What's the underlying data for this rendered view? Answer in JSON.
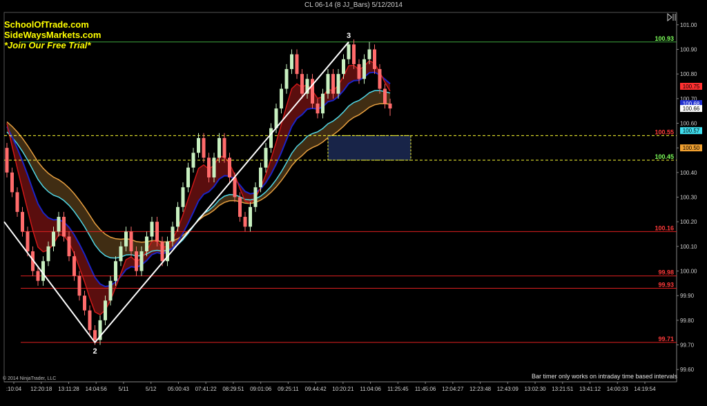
{
  "chart_title": "CL 06-14 (8 JJ_Bars)  5/12/2014",
  "watermark": [
    "SchoolOfTrade.com",
    "SideWaysMarkets.com",
    "*Join Our Free Trial*"
  ],
  "copyright": "© 2014 NinjaTrader, LLC",
  "bar_timer_note": "Bar timer only works on intraday time based intervals",
  "colors": {
    "background": "#000000",
    "bar_up": "#c8f0c0",
    "bar_down": "#ff6b6b",
    "zigzag": "#ffffff",
    "level_green": "#3ea53e",
    "level_red": "#e02020",
    "level_yellow": "#ffff33",
    "zone_fill": "#1c2a55",
    "ema_fast": "#d01818",
    "ema_mid": "#1a24c8",
    "ema_slow_a": "#50d8e8",
    "ema_slow_b": "#e8a040"
  },
  "chart_data": {
    "type": "candlestick",
    "instrument": "CL 06-14",
    "ylim": [
      99.55,
      101.05
    ],
    "y_ticks": [
      "101.00",
      "100.90",
      "100.80",
      "100.70",
      "100.60",
      "100.50",
      "100.40",
      "100.30",
      "100.20",
      "100.10",
      "100.00",
      "99.90",
      "99.80",
      "99.70",
      "99.60"
    ],
    "x_ticks": [
      ":10:04",
      "12:20:18",
      "13:11:28",
      "14:04:56",
      "5/11",
      "5/12",
      "05:00:43",
      "07:41:22",
      "08:29:51",
      "09:01:06",
      "09:25:11",
      "09:44:42",
      "10:20:21",
      "11:04:06",
      "11:25:45",
      "11:45:06",
      "12:04:27",
      "12:23:48",
      "12:43:09",
      "13:02:30",
      "13:21:51",
      "13:41:12",
      "14:00:33",
      "14:19:54"
    ],
    "bars": [
      [
        100.5,
        100.52,
        100.38,
        100.4
      ],
      [
        100.4,
        100.42,
        100.3,
        100.32
      ],
      [
        100.32,
        100.34,
        100.22,
        100.24
      ],
      [
        100.24,
        100.26,
        100.14,
        100.16
      ],
      [
        100.16,
        100.18,
        100.06,
        100.08
      ],
      [
        100.08,
        100.1,
        99.98,
        100.0
      ],
      [
        100.0,
        100.02,
        99.94,
        99.96
      ],
      [
        99.96,
        100.06,
        99.94,
        100.04
      ],
      [
        100.04,
        100.12,
        100.02,
        100.1
      ],
      [
        100.1,
        100.18,
        100.08,
        100.16
      ],
      [
        100.16,
        100.24,
        100.14,
        100.22
      ],
      [
        100.22,
        100.24,
        100.12,
        100.14
      ],
      [
        100.14,
        100.16,
        100.04,
        100.06
      ],
      [
        100.06,
        100.08,
        99.96,
        99.98
      ],
      [
        99.98,
        100.0,
        99.88,
        99.9
      ],
      [
        99.9,
        99.92,
        99.82,
        99.84
      ],
      [
        99.84,
        99.86,
        99.74,
        99.76
      ],
      [
        99.76,
        99.78,
        99.7,
        99.72
      ],
      [
        99.72,
        99.82,
        99.7,
        99.8
      ],
      [
        99.8,
        99.9,
        99.78,
        99.88
      ],
      [
        99.88,
        99.98,
        99.86,
        99.96
      ],
      [
        99.96,
        100.06,
        99.94,
        100.04
      ],
      [
        100.04,
        100.12,
        100.02,
        100.1
      ],
      [
        100.1,
        100.18,
        100.08,
        100.16
      ],
      [
        100.16,
        100.18,
        100.06,
        100.08
      ],
      [
        100.08,
        100.1,
        99.98,
        100.0
      ],
      [
        100.0,
        100.1,
        99.98,
        100.08
      ],
      [
        100.08,
        100.16,
        100.06,
        100.14
      ],
      [
        100.14,
        100.22,
        100.12,
        100.2
      ],
      [
        100.2,
        100.22,
        100.1,
        100.12
      ],
      [
        100.12,
        100.14,
        100.02,
        100.04
      ],
      [
        100.04,
        100.14,
        100.02,
        100.12
      ],
      [
        100.12,
        100.2,
        100.1,
        100.18
      ],
      [
        100.18,
        100.28,
        100.16,
        100.26
      ],
      [
        100.26,
        100.36,
        100.24,
        100.34
      ],
      [
        100.34,
        100.44,
        100.32,
        100.42
      ],
      [
        100.42,
        100.5,
        100.4,
        100.48
      ],
      [
        100.48,
        100.56,
        100.46,
        100.54
      ],
      [
        100.54,
        100.56,
        100.44,
        100.46
      ],
      [
        100.46,
        100.48,
        100.36,
        100.38
      ],
      [
        100.38,
        100.48,
        100.36,
        100.46
      ],
      [
        100.46,
        100.56,
        100.44,
        100.54
      ],
      [
        100.54,
        100.56,
        100.44,
        100.46
      ],
      [
        100.46,
        100.48,
        100.36,
        100.38
      ],
      [
        100.38,
        100.4,
        100.28,
        100.3
      ],
      [
        100.3,
        100.32,
        100.2,
        100.22
      ],
      [
        100.22,
        100.24,
        100.16,
        100.18
      ],
      [
        100.18,
        100.28,
        100.16,
        100.26
      ],
      [
        100.26,
        100.36,
        100.24,
        100.34
      ],
      [
        100.34,
        100.44,
        100.32,
        100.42
      ],
      [
        100.42,
        100.52,
        100.4,
        100.5
      ],
      [
        100.5,
        100.6,
        100.48,
        100.58
      ],
      [
        100.58,
        100.68,
        100.56,
        100.66
      ],
      [
        100.66,
        100.76,
        100.64,
        100.74
      ],
      [
        100.74,
        100.84,
        100.72,
        100.82
      ],
      [
        100.82,
        100.9,
        100.8,
        100.88
      ],
      [
        100.88,
        100.9,
        100.78,
        100.8
      ],
      [
        100.8,
        100.82,
        100.7,
        100.72
      ],
      [
        100.72,
        100.8,
        100.7,
        100.78
      ],
      [
        100.78,
        100.8,
        100.66,
        100.68
      ],
      [
        100.68,
        100.7,
        100.62,
        100.64
      ],
      [
        100.64,
        100.74,
        100.62,
        100.72
      ],
      [
        100.72,
        100.82,
        100.7,
        100.8
      ],
      [
        100.8,
        100.82,
        100.7,
        100.72
      ],
      [
        100.72,
        100.82,
        100.7,
        100.8
      ],
      [
        100.8,
        100.88,
        100.78,
        100.86
      ],
      [
        100.86,
        100.93,
        100.84,
        100.92
      ],
      [
        100.92,
        100.94,
        100.82,
        100.84
      ],
      [
        100.84,
        100.86,
        100.76,
        100.78
      ],
      [
        100.78,
        100.88,
        100.76,
        100.86
      ],
      [
        100.86,
        100.93,
        100.84,
        100.9
      ],
      [
        100.9,
        100.92,
        100.8,
        100.82
      ],
      [
        100.82,
        100.84,
        100.72,
        100.74
      ],
      [
        100.74,
        100.76,
        100.66,
        100.68
      ],
      [
        100.68,
        100.7,
        100.63,
        100.66
      ]
    ],
    "levels": [
      {
        "label": "100.93",
        "value": 100.93,
        "color": "green"
      },
      {
        "label": "100.55",
        "value": 100.55,
        "color": "red"
      },
      {
        "label": "100.45",
        "value": 100.45,
        "color": "green"
      },
      {
        "label": "100.16",
        "value": 100.16,
        "color": "red"
      },
      {
        "label": "99.98",
        "value": 99.98,
        "color": "red"
      },
      {
        "label": "99.93",
        "value": 99.93,
        "color": "red"
      },
      {
        "label": "99.71",
        "value": 99.71,
        "color": "red"
      }
    ],
    "price_flags": [
      {
        "label": "100.75",
        "value": 100.75,
        "bg": "#ff3030",
        "fg": "#000000"
      },
      {
        "label": "100.68",
        "value": 100.68,
        "bg": "#2030d0",
        "fg": "#ffffff"
      },
      {
        "label": "100.66",
        "value": 100.66,
        "bg": "#ffffff",
        "fg": "#000000"
      },
      {
        "label": "100.57",
        "value": 100.57,
        "bg": "#40e0f0",
        "fg": "#000000"
      },
      {
        "label": "100.50",
        "value": 100.5,
        "bg": "#f0a030",
        "fg": "#000000"
      }
    ],
    "zigzag_labels": [
      "2",
      "3"
    ],
    "zigzag": [
      [
        0,
        100.2
      ],
      [
        17,
        99.71
      ],
      [
        66,
        100.93
      ],
      [
        17,
        99.71
      ]
    ],
    "zone": {
      "from_bar": 62,
      "to_bar": 78,
      "top": 100.55,
      "bottom": 100.45
    },
    "grid": false
  }
}
